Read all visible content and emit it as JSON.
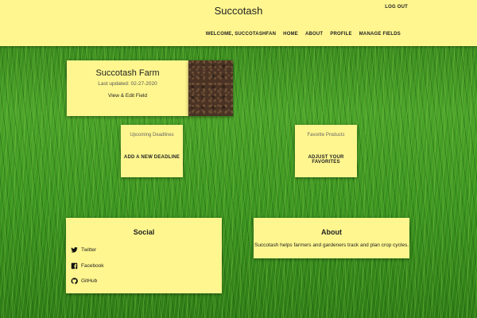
{
  "header": {
    "brand": "Succotash",
    "logout_label": "LOG OUT",
    "nav": [
      {
        "label": "WELCOME, SUCCOTASHFAN"
      },
      {
        "label": "HOME"
      },
      {
        "label": "ABOUT"
      },
      {
        "label": "PROFILE"
      },
      {
        "label": "MANAGE FIELDS"
      }
    ]
  },
  "farm": {
    "title": "Succotash Farm",
    "updated": "Last updated: 02-27-2020",
    "link_label": "View & Edit Field"
  },
  "deadlines": {
    "title": "Upcoming Deadlines",
    "action_label": "ADD A NEW DEADLINE"
  },
  "favorites": {
    "title": "Favorite Products",
    "action_label": "ADJUST YOUR FAVORITES"
  },
  "social": {
    "title": "Social",
    "items": [
      {
        "label": "Twitter",
        "icon": "twitter-icon"
      },
      {
        "label": "Facebook",
        "icon": "facebook-icon"
      },
      {
        "label": "GitHub",
        "icon": "github-icon"
      }
    ]
  },
  "about": {
    "title": "About",
    "text": "Succotash helps farmers and gardeners track and plan crop cycles."
  },
  "colors": {
    "card_background": "#fff68f",
    "header_background": "#fff68f",
    "grass": "#3f8f22"
  }
}
